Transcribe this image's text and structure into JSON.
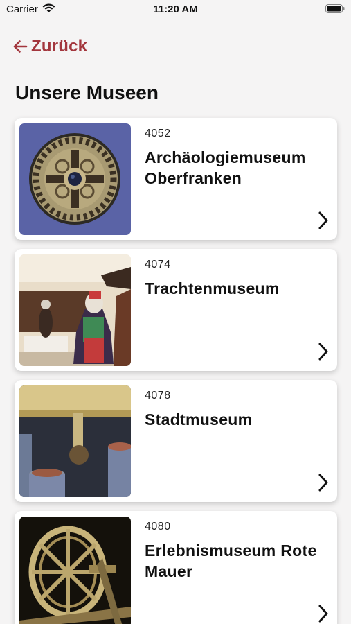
{
  "status_bar": {
    "carrier": "Carrier",
    "time": "11:20 AM"
  },
  "navigation": {
    "back_label": "Zurück"
  },
  "page": {
    "title": "Unsere Museen"
  },
  "colors": {
    "accent": "#a3363d",
    "background": "#f5f4f4",
    "card": "#ffffff"
  },
  "museums": [
    {
      "number": "4052",
      "name": "Archäologiemuseum Oberfranken",
      "image": "bronze-disc-brooch"
    },
    {
      "number": "4074",
      "name": "Trachtenmuseum",
      "image": "traditional-costumes-exhibit"
    },
    {
      "number": "4078",
      "name": "Stadtmuseum",
      "image": "seal-display-exhibit"
    },
    {
      "number": "4080",
      "name": "Erlebnismuseum Rote Mauer",
      "image": "wooden-wheel-exhibit"
    }
  ]
}
